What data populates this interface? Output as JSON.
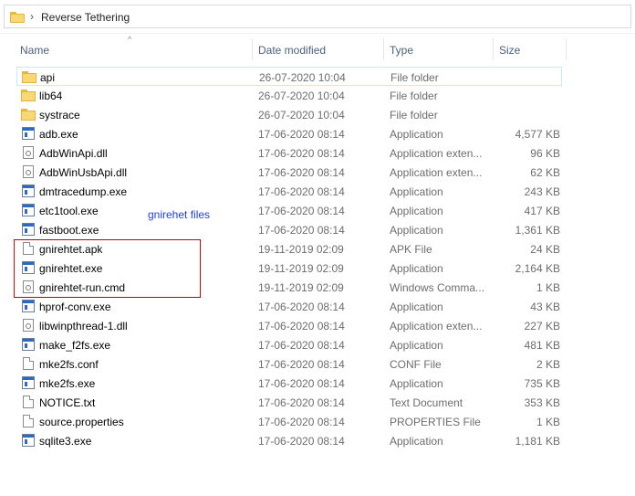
{
  "address": {
    "crumb": "Reverse Tethering",
    "icon": "folder-icon"
  },
  "columns": {
    "name": "Name",
    "date": "Date modified",
    "type": "Type",
    "size": "Size"
  },
  "annotation": {
    "label": "gnirehet files",
    "box_color": "#c00000",
    "label_color": "#1f3fd0"
  },
  "files": [
    {
      "name": "api",
      "date": "26-07-2020 10:04",
      "type": "File folder",
      "size": "",
      "icon": "folder"
    },
    {
      "name": "lib64",
      "date": "26-07-2020 10:04",
      "type": "File folder",
      "size": "",
      "icon": "folder"
    },
    {
      "name": "systrace",
      "date": "26-07-2020 10:04",
      "type": "File folder",
      "size": "",
      "icon": "folder"
    },
    {
      "name": "adb.exe",
      "date": "17-06-2020 08:14",
      "type": "Application",
      "size": "4,577 KB",
      "icon": "app"
    },
    {
      "name": "AdbWinApi.dll",
      "date": "17-06-2020 08:14",
      "type": "Application exten...",
      "size": "96 KB",
      "icon": "dll"
    },
    {
      "name": "AdbWinUsbApi.dll",
      "date": "17-06-2020 08:14",
      "type": "Application exten...",
      "size": "62 KB",
      "icon": "dll"
    },
    {
      "name": "dmtracedump.exe",
      "date": "17-06-2020 08:14",
      "type": "Application",
      "size": "243 KB",
      "icon": "app"
    },
    {
      "name": "etc1tool.exe",
      "date": "17-06-2020 08:14",
      "type": "Application",
      "size": "417 KB",
      "icon": "app"
    },
    {
      "name": "fastboot.exe",
      "date": "17-06-2020 08:14",
      "type": "Application",
      "size": "1,361 KB",
      "icon": "app"
    },
    {
      "name": "gnirehtet.apk",
      "date": "19-11-2019 02:09",
      "type": "APK File",
      "size": "24 KB",
      "icon": "doc"
    },
    {
      "name": "gnirehtet.exe",
      "date": "19-11-2019 02:09",
      "type": "Application",
      "size": "2,164 KB",
      "icon": "app"
    },
    {
      "name": "gnirehtet-run.cmd",
      "date": "19-11-2019 02:09",
      "type": "Windows Comma...",
      "size": "1 KB",
      "icon": "cmd"
    },
    {
      "name": "hprof-conv.exe",
      "date": "17-06-2020 08:14",
      "type": "Application",
      "size": "43 KB",
      "icon": "app"
    },
    {
      "name": "libwinpthread-1.dll",
      "date": "17-06-2020 08:14",
      "type": "Application exten...",
      "size": "227 KB",
      "icon": "dll"
    },
    {
      "name": "make_f2fs.exe",
      "date": "17-06-2020 08:14",
      "type": "Application",
      "size": "481 KB",
      "icon": "app"
    },
    {
      "name": "mke2fs.conf",
      "date": "17-06-2020 08:14",
      "type": "CONF File",
      "size": "2 KB",
      "icon": "doc"
    },
    {
      "name": "mke2fs.exe",
      "date": "17-06-2020 08:14",
      "type": "Application",
      "size": "735 KB",
      "icon": "app"
    },
    {
      "name": "NOTICE.txt",
      "date": "17-06-2020 08:14",
      "type": "Text Document",
      "size": "353 KB",
      "icon": "doc"
    },
    {
      "name": "source.properties",
      "date": "17-06-2020 08:14",
      "type": "PROPERTIES File",
      "size": "1 KB",
      "icon": "doc"
    },
    {
      "name": "sqlite3.exe",
      "date": "17-06-2020 08:14",
      "type": "Application",
      "size": "1,181 KB",
      "icon": "app"
    }
  ]
}
